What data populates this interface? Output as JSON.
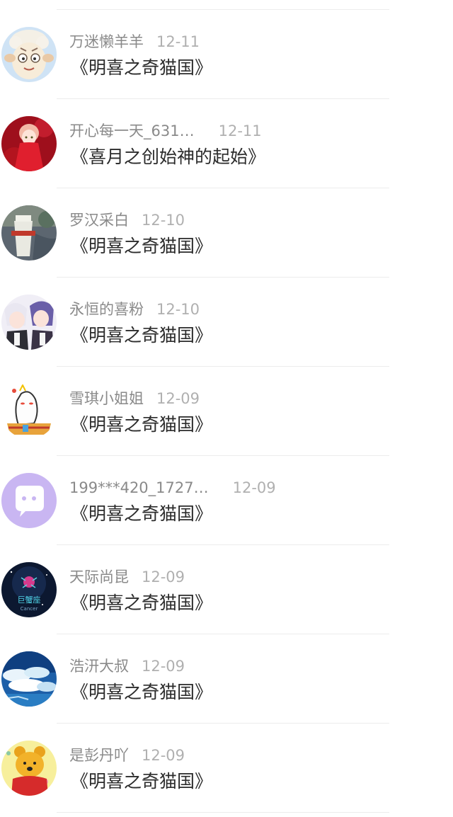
{
  "comments": [
    {
      "user": "万迷懒羊羊",
      "date": "12-11",
      "title": "《明喜之奇猫国》",
      "avatar": "lazy-goat-cartoon-icon"
    },
    {
      "user": "开心每一天_631…",
      "date": "12-11",
      "title": "《喜月之创始神的起始》",
      "avatar": "anime-girl-red-dress-icon"
    },
    {
      "user": "罗汉采白",
      "date": "12-10",
      "title": "《明喜之奇猫国》",
      "avatar": "drink-cup-photo-icon"
    },
    {
      "user": "永恒的喜粉",
      "date": "12-10",
      "title": "《明喜之奇猫国》",
      "avatar": "anime-couple-icon"
    },
    {
      "user": "雪琪小姐姐",
      "date": "12-09",
      "title": "《明喜之奇猫国》",
      "avatar": "cartoon-ghost-mascot-icon"
    },
    {
      "user": "199***420_1727…",
      "date": "12-09",
      "title": "《明喜之奇猫国》",
      "avatar": "default-chat-bubble-icon"
    },
    {
      "user": "天际尚昆",
      "date": "12-09",
      "title": "《明喜之奇猫国》",
      "avatar": "zodiac-cancer-icon"
    },
    {
      "user": "浩汧大叔",
      "date": "12-09",
      "title": "《明喜之奇猫国》",
      "avatar": "sky-clouds-icon"
    },
    {
      "user": "是彭丹吖",
      "date": "12-09",
      "title": "《明喜之奇猫国》",
      "avatar": "winnie-the-pooh-icon"
    }
  ],
  "avatar_glyphs": {
    "zodiac_text": "巨蟹座",
    "zodiac_sub": "Cancer"
  },
  "colors": {
    "username": "#8a8a8a",
    "date": "#b0b0b0",
    "title": "#2b2b2b",
    "divider": "#ececec",
    "default_avatar": "#c9b6f2"
  }
}
